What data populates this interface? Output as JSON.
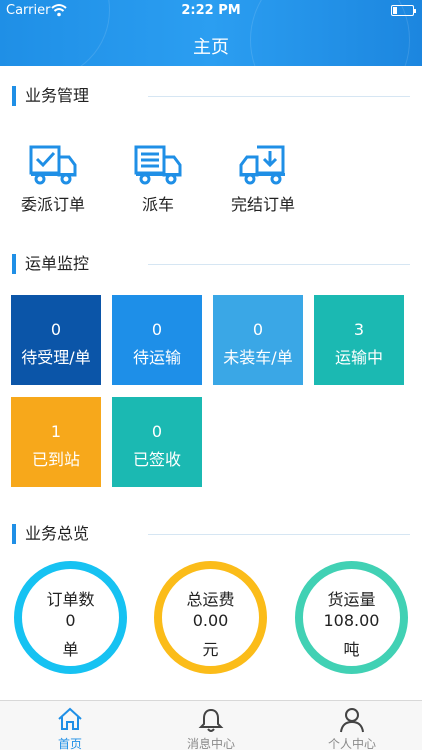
{
  "status_bar": {
    "carrier": "Carrier",
    "time": "2:22 PM"
  },
  "header": {
    "title": "主页"
  },
  "sections": {
    "business_mgmt": "业务管理",
    "waybill_monitor": "运单监控",
    "business_overview": "业务总览"
  },
  "management": [
    {
      "label": "委派订单",
      "icon": "truck-check-icon"
    },
    {
      "label": "派车",
      "icon": "truck-list-icon"
    },
    {
      "label": "完结订单",
      "icon": "truck-download-icon"
    }
  ],
  "monitor_tiles": [
    {
      "count": "0",
      "label": "待受理/单",
      "color": "#0b55a8"
    },
    {
      "count": "0",
      "label": "待运输",
      "color": "#1e8fe8"
    },
    {
      "count": "0",
      "label": "未装车/单",
      "color": "#3aa7e6"
    },
    {
      "count": "3",
      "label": "运输中",
      "color": "#1bb9b2"
    },
    {
      "count": "1",
      "label": "已到站",
      "color": "#f7a81b"
    },
    {
      "count": "0",
      "label": "已签收",
      "color": "#1bb9b2"
    }
  ],
  "overview": [
    {
      "title": "订单数",
      "value": "0",
      "unit": "单",
      "color": "#16c2f2"
    },
    {
      "title": "总运费",
      "value": "0.00",
      "unit": "元",
      "color": "#fbbc19"
    },
    {
      "title": "货运量",
      "value": "108.00",
      "unit": "吨",
      "color": "#41d1b4"
    }
  ],
  "tabbar": [
    {
      "label": "首页",
      "icon": "home-icon",
      "active": true
    },
    {
      "label": "消息中心",
      "icon": "bell-icon",
      "active": false
    },
    {
      "label": "个人中心",
      "icon": "person-icon",
      "active": false
    }
  ]
}
